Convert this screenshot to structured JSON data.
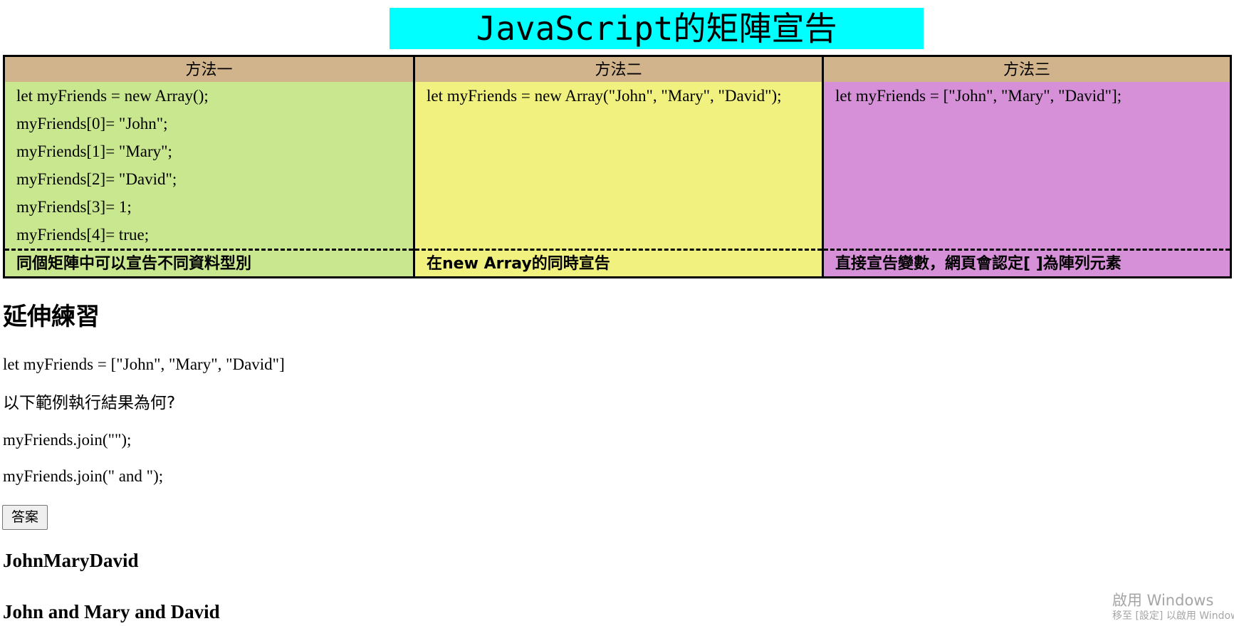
{
  "page": {
    "title": "JavaScript的矩陣宣告"
  },
  "methods": [
    {
      "label": "方法一",
      "code_lines": [
        "let myFriends = new Array();",
        "myFriends[0]= \"John\";",
        "myFriends[1]= \"Mary\";",
        "myFriends[2]= \"David\";",
        "myFriends[3]= 1;",
        "myFriends[4]= true;"
      ],
      "note": "同個矩陣中可以宣告不同資料型別"
    },
    {
      "label": "方法二",
      "code_lines": [
        "let myFriends = new Array(\"John\", \"Mary\", \"David\");"
      ],
      "note": "在new Array的同時宣告"
    },
    {
      "label": "方法三",
      "code_lines": [
        "let myFriends = [\"John\", \"Mary\", \"David\"];"
      ],
      "note": "直接宣告變數，網頁會認定[ ]為陣列元素"
    }
  ],
  "exercise": {
    "heading": "延伸練習",
    "array_line": "let myFriends = [\"John\", \"Mary\", \"David\"]",
    "question": "以下範例執行結果為何?",
    "join_empty": "myFriends.join(\"\");",
    "join_and": "myFriends.join(\" and \");",
    "button_label": "答案",
    "result_1": "JohnMaryDavid",
    "result_2": "John and Mary and David"
  },
  "watermark": {
    "main": "啟用 Windows",
    "sub": "移至 [設定] 以啟用 Windows"
  },
  "colors": {
    "title_background": "#00ffff",
    "header_background": "#d2b48c",
    "method_one": "#c9e78f",
    "method_two": "#f1f17f",
    "method_three": "#d590d8"
  }
}
